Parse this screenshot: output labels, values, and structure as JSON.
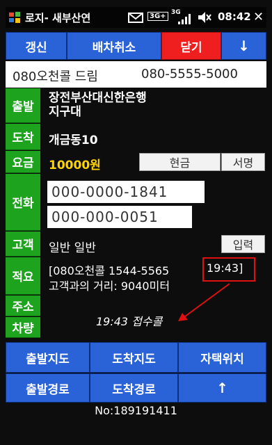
{
  "status": {
    "app_title": "로지- 새부산연",
    "signal_1": "3G+",
    "signal_2": "3G",
    "time": "08:42",
    "close_glyph": "✕"
  },
  "toolbar": {
    "refresh": "갱신",
    "cancel_dispatch": "배차취소",
    "close": "닫기",
    "down_arrow": "↓"
  },
  "call": {
    "caller": "080오천콜 드림",
    "phone": "080-5555-5000"
  },
  "fields": {
    "departure_label": "출발",
    "departure_value": "장전부산대신한은행\n지구대",
    "arrival_label": "도착",
    "arrival_value": "개금동10",
    "fare_label": "요금",
    "fare_value": "10000원",
    "pay_cash": "현금",
    "pay_sign": "서명",
    "phone_label": "전화",
    "phone_1": "000-0000-1841",
    "phone_2": "000-000-0051",
    "customer_label": "고객",
    "customer_value": "일반 일반",
    "input_button": "입력",
    "note_label": "적요",
    "note_line1": "[080오천콜 1544-5565",
    "note_time": "19:43]",
    "note_line2": "고객과의 거리: 9040미터",
    "address_label": "주소",
    "vehicle_label": "차량",
    "annotation": "19:43 접수콜"
  },
  "bottom": {
    "start_map": "출발지도",
    "arrive_map": "도착지도",
    "my_location": "자택위치",
    "start_route": "출발경로",
    "arrive_route": "도착경로",
    "up_arrow": "↑",
    "order_no": "No:189191411"
  },
  "colors": {
    "blue": "#2a63d8",
    "red": "#f01f1f",
    "green": "#1ea31e",
    "yellow": "#ffd400",
    "annotation_red": "#e01010"
  }
}
